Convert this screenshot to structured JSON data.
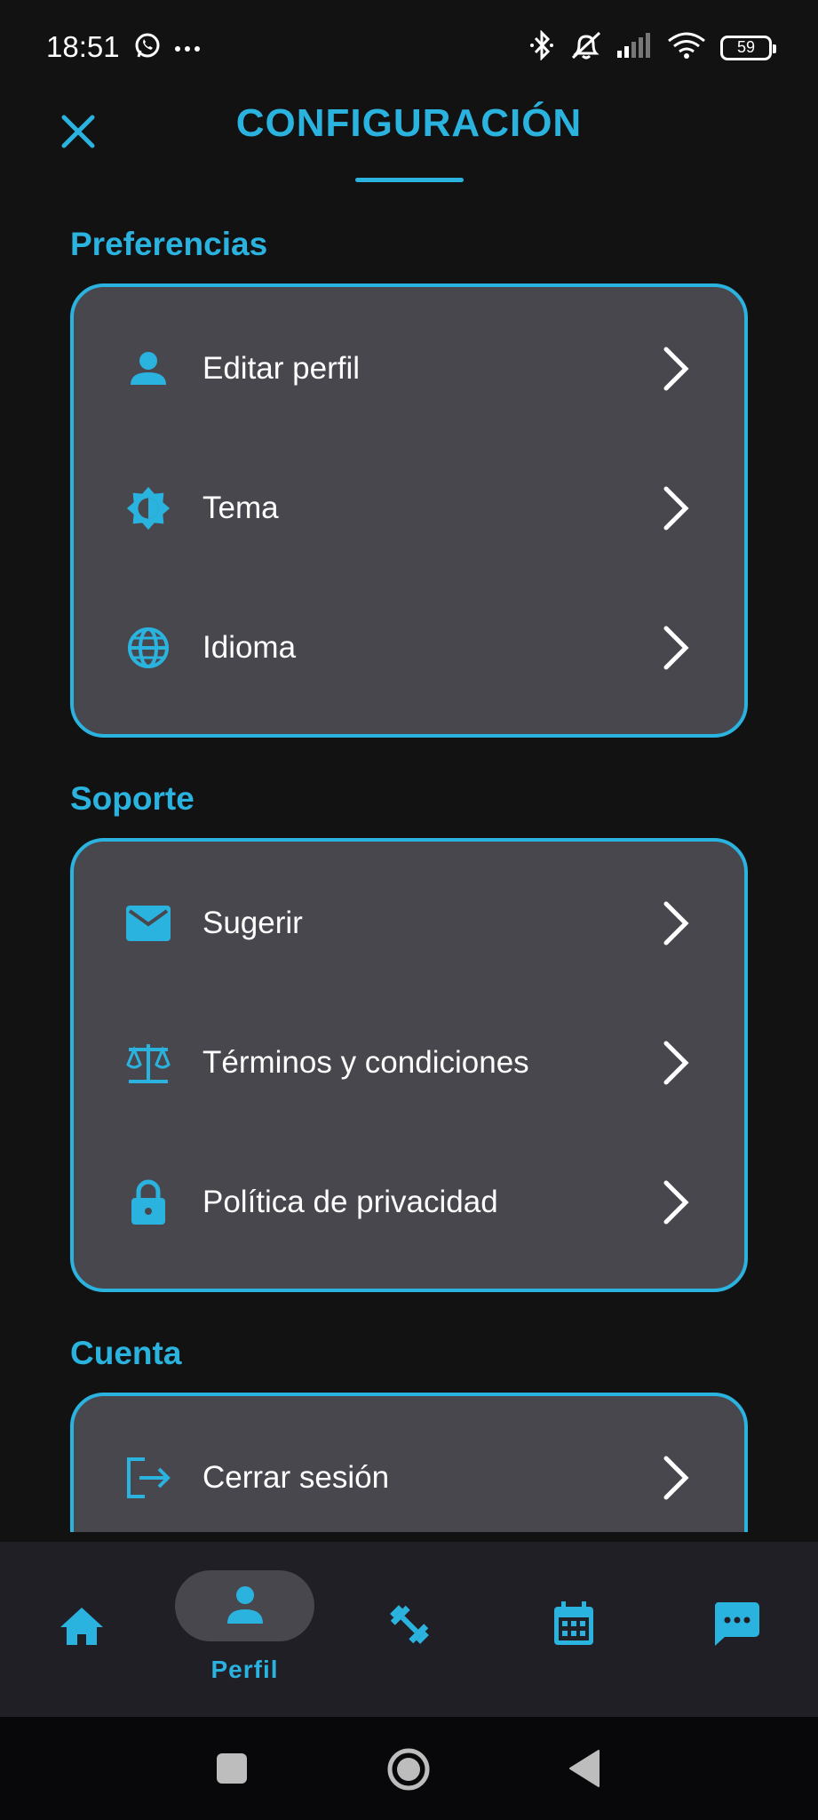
{
  "status_bar": {
    "time": "18:51",
    "battery": "59"
  },
  "header": {
    "title": "CONFIGURACIÓN"
  },
  "sections": {
    "preferences": {
      "title": "Preferencias",
      "items": [
        {
          "label": "Editar perfil",
          "icon": "person-icon"
        },
        {
          "label": "Tema",
          "icon": "brightness-icon"
        },
        {
          "label": "Idioma",
          "icon": "globe-icon"
        }
      ]
    },
    "support": {
      "title": "Soporte",
      "items": [
        {
          "label": "Sugerir",
          "icon": "mail-icon"
        },
        {
          "label": "Términos y condiciones",
          "icon": "scale-icon"
        },
        {
          "label": "Política de privacidad",
          "icon": "lock-icon"
        }
      ]
    },
    "account": {
      "title": "Cuenta",
      "items": [
        {
          "label": "Cerrar sesión",
          "icon": "logout-icon"
        }
      ]
    }
  },
  "bottom_nav": {
    "items": [
      {
        "icon": "home-icon",
        "label": ""
      },
      {
        "icon": "person-icon",
        "label": "Perfil",
        "active": true
      },
      {
        "icon": "dumbbell-icon",
        "label": ""
      },
      {
        "icon": "calendar-icon",
        "label": ""
      },
      {
        "icon": "chat-icon",
        "label": ""
      }
    ]
  },
  "colors": {
    "accent": "#2BB3E0",
    "background": "#121212",
    "card": "#48474E",
    "nav": "#201F26"
  }
}
